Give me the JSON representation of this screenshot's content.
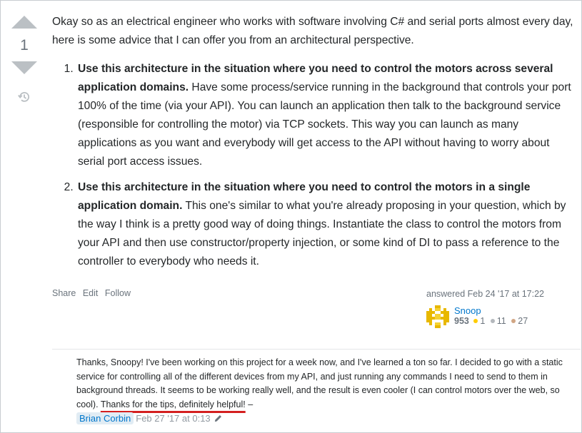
{
  "vote": {
    "count": "1"
  },
  "answer": {
    "intro": "Okay so as an electrical engineer who works with software involving C# and serial ports almost every day, here is some advice that I can offer you from an architectural perspective.",
    "items": [
      {
        "bold": "Use this architecture in the situation where you need to control the motors across several application domains.",
        "text": " Have some process/service running in the background that controls your port 100% of the time (via your API). You can launch an application then talk to the background service (responsible for controlling the motor) via TCP sockets. This way you can launch as many applications as you want and everybody will get access to the API without having to worry about serial port access issues."
      },
      {
        "bold": "Use this architecture in the situation where you need to control the motors in a single application domain.",
        "text": " This one's similar to what you're already proposing in your question, which by the way I think is a pretty good way of doing things. Instantiate the class to control the motors from your API and then use constructor/property injection, or some kind of DI to pass a reference to the controller to everybody who needs it."
      }
    ]
  },
  "menu": {
    "share": "Share",
    "edit": "Edit",
    "follow": "Follow"
  },
  "signature": {
    "action": "answered Feb 24 '17 at 17:22",
    "user": "Snoop",
    "reputation": "953",
    "gold": "1",
    "silver": "11",
    "bronze": "27"
  },
  "comment": {
    "text": "Thanks, Snoopy! I've been working on this project for a week now, and I've learned a ton so far. I decided to go with a static service for controlling all of the different devices from my API, and just running any commands I need to send to them in background threads. It seems to be working really well, and the result is even cooler (I can control motors over the web, so cool). ",
    "highlight": "Thanks for the tips, definitely helpful!",
    "dash": " – ",
    "user": "Brian Corbin",
    "date": "Feb 27 '17 at 0:13"
  },
  "colors": {
    "link": "#0077cc",
    "highlight_underline": "#d42020",
    "vote_arrow": "#bbc0c4"
  }
}
